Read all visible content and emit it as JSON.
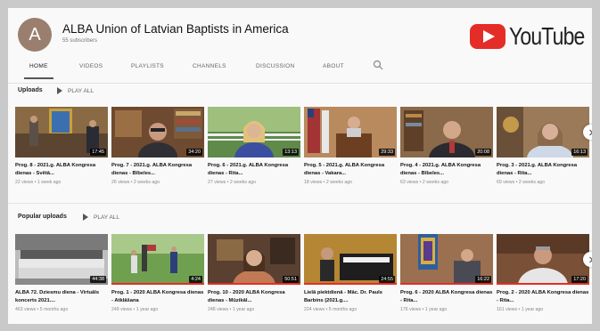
{
  "channel": {
    "avatar_letter": "A",
    "name": "ALBA Union of Latvian Baptists in America",
    "subscribers": "55 subscribers"
  },
  "logo": {
    "word": "YouTube",
    "brand_color": "#e52d27"
  },
  "tabs": [
    {
      "label": "HOME",
      "active": true
    },
    {
      "label": "VIDEOS"
    },
    {
      "label": "PLAYLISTS"
    },
    {
      "label": "CHANNELS"
    },
    {
      "label": "DISCUSSION"
    },
    {
      "label": "ABOUT"
    }
  ],
  "search_icon": "search-icon",
  "uploads": {
    "title": "Uploads",
    "play_all": "PLAY ALL",
    "videos": [
      {
        "title": "Prog. 8 - 2021.g. ALBA Kongresa dienas - Svētā...",
        "meta": "22 views • 1 week ago",
        "duration": "17:45",
        "progress": 0.0
      },
      {
        "title": "Prog. 7 - 2021.g. ALBA Kongresa dienas - Bībeles...",
        "meta": "26 views • 2 weeks ago",
        "duration": "34:20",
        "progress": 0.0
      },
      {
        "title": "Prog. 6 - 2021.g. ALBA Kongresa dienas - Rita...",
        "meta": "27 views • 2 weeks ago",
        "duration": "13:13",
        "progress": 0.0
      },
      {
        "title": "Prog. 5 - 2021.g. ALBA Kongresa dienas - Vakara...",
        "meta": "18 views • 2 weeks ago",
        "duration": "29:33",
        "progress": 0.0
      },
      {
        "title": "Prog. 4 - 2021.g. ALBA Kongresa dienas - Bībeles...",
        "meta": "63 views • 2 weeks ago",
        "duration": "20:08",
        "progress": 0.0
      },
      {
        "title": "Prog. 3 - 2021.g. ALBA Kongresa dienas - Rita...",
        "meta": "69 views • 2 weeks ago",
        "duration": "16:13",
        "progress": 0.0
      }
    ]
  },
  "popular": {
    "title": "Popular uploads",
    "play_all": "PLAY ALL",
    "videos": [
      {
        "title": "ALBA 72. Dziesmu diena - Virtuāls koncerts 2021....",
        "meta": "463 views • 5 months ago",
        "duration": "44:38",
        "progress": 0.0
      },
      {
        "title": "Prog. 1 - 2020 ALBA Kongresa dienas - Atklāšana",
        "meta": "249 views • 1 year ago",
        "duration": "4:24",
        "progress": 1.0
      },
      {
        "title": "Prog. 10 - 2020 ALBA Kongresa dienas - Mūzikāl...",
        "meta": "248 views • 1 year ago",
        "duration": "50:51",
        "progress": 1.0
      },
      {
        "title": "Lielā piektdienā - Māc. Dr. Pauls Barbins (2021.g....",
        "meta": "224 views • 5 months ago",
        "duration": "24:55",
        "progress": 1.0
      },
      {
        "title": "Prog. 6 - 2020 ALBA Kongresa dienas - Rita...",
        "meta": "176 views • 1 year ago",
        "duration": "16:22",
        "progress": 1.0
      },
      {
        "title": "Prog. 2 - 2020 ALBA Kongresa dienas - Rita...",
        "meta": "161 views • 1 year ago",
        "duration": "17:20",
        "progress": 1.0
      }
    ]
  }
}
